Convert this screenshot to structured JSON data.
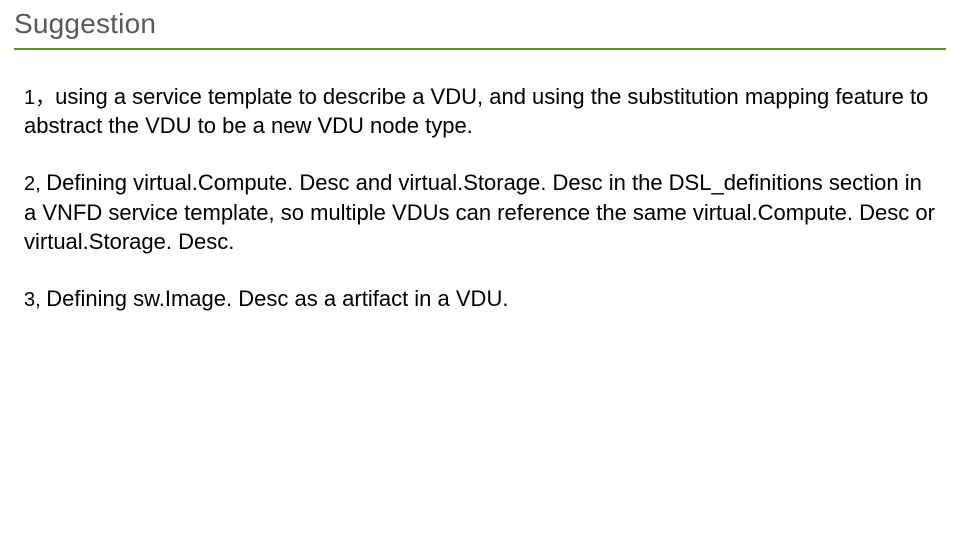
{
  "title": "Suggestion",
  "items": [
    {
      "num": "1，",
      "text": "using a service template to describe a VDU, and using the substitution mapping feature to abstract the VDU to be a new VDU node type."
    },
    {
      "num": "2,  ",
      "text": "Defining virtual.Compute. Desc and virtual.Storage. Desc in the DSL_definitions section in a VNFD service template, so multiple VDUs can reference the same virtual.Compute. Desc or virtual.Storage. Desc."
    },
    {
      "num": "3,  ",
      "text": "Defining sw.Image. Desc as a artifact in a VDU."
    }
  ]
}
